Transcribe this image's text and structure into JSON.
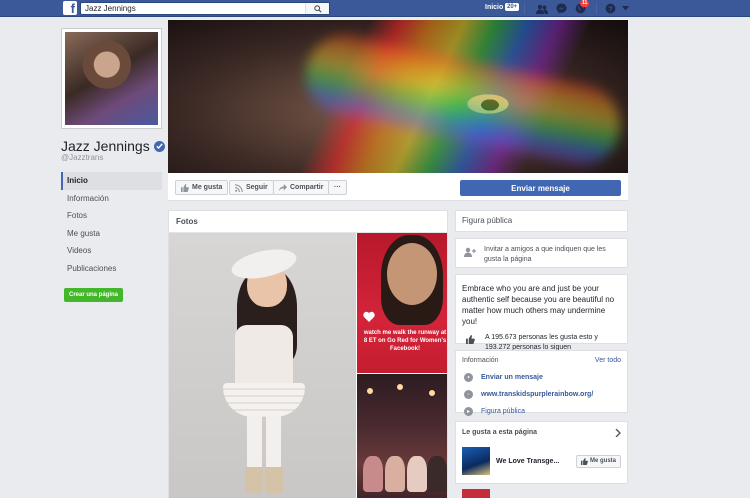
{
  "topbar": {
    "search_value": "Jazz Jennings",
    "home_label": "Inicio",
    "home_count": "20+",
    "notifications_count": "11"
  },
  "profile": {
    "name": "Jazz Jennings",
    "handle": "@Jazztrans"
  },
  "nav": {
    "items": [
      {
        "label": "Inicio"
      },
      {
        "label": "Información"
      },
      {
        "label": "Fotos"
      },
      {
        "label": "Me gusta"
      },
      {
        "label": "Videos"
      },
      {
        "label": "Publicaciones"
      }
    ],
    "create_page_label": "Crear una página"
  },
  "actions": {
    "like_label": "Me gusta",
    "follow_label": "Seguir",
    "share_label": "Compartir",
    "more_label": "···",
    "send_message_label": "Enviar mensaje"
  },
  "photos": {
    "title": "Fotos",
    "tile_caption": "watch me walk the runway at 8 ET on Go Red for Women's Facebook!"
  },
  "sidebar": {
    "category": "Figura pública",
    "invite_text": "Invitar a amigos a que indiquen que les gusta la página",
    "about_text": "Embrace who you are and just be your authentic self because you are beautiful no matter how much others may undermine you!",
    "likes_text": "A 195.673 personas les gusta esto y 193.272 personas lo siguen",
    "info_title": "Información",
    "info_see_all": "Ver todo",
    "info_send_message": "Enviar un mensaje",
    "info_website": "www.transkidspurplerainbow.org/",
    "info_category": "Figura pública",
    "liked_pages_title": "Le gusta a esta página",
    "liked_page_name": "We Love Transge...",
    "liked_page_button": "Me gusta"
  },
  "colors": {
    "brand_blue": "#3b5998",
    "button_blue": "#4267b2",
    "create_green": "#42b72a",
    "notification_red": "#fa3e3e",
    "link_blue": "#365899"
  },
  "icons": [
    "facebook-logo-icon",
    "search-icon",
    "friends-icon",
    "messenger-icon",
    "globe-notification-icon",
    "help-icon",
    "caret-down-icon",
    "verified-badge-icon",
    "thumbs-up-icon",
    "rss-follow-icon",
    "share-arrow-icon",
    "add-person-icon",
    "messenger-small-icon",
    "globe-icon",
    "flag-icon",
    "chevron-right-icon"
  ]
}
